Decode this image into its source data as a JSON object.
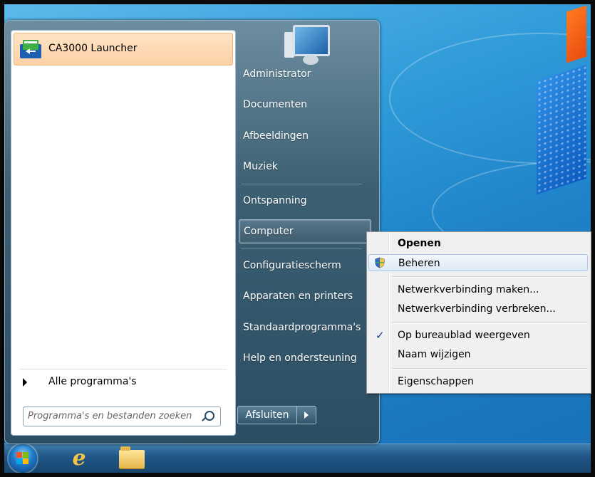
{
  "colors": {
    "accent": "#fdd1a6",
    "desktop": "#2e9ad8",
    "menu_text": "#ffffff"
  },
  "start_menu": {
    "pinned": [
      {
        "label": "CA3000 Launcher",
        "icon": "ca3000-launcher-icon"
      }
    ],
    "all_programs_label": "Alle programma's",
    "search_placeholder": "Programma's en bestanden zoeken",
    "right_pane": [
      {
        "label": "Administrator"
      },
      {
        "label": "Documenten"
      },
      {
        "label": "Afbeeldingen"
      },
      {
        "label": "Muziek"
      },
      {
        "label": "Ontspanning"
      },
      {
        "label": "Computer"
      },
      {
        "label": "Configuratiescherm"
      },
      {
        "label": "Apparaten en printers"
      },
      {
        "label": "Standaardprogramma's"
      },
      {
        "label": "Help en ondersteuning"
      }
    ],
    "shutdown_label": "Afsluiten"
  },
  "context_menu": {
    "items": [
      {
        "label": "Openen"
      },
      {
        "label": "Beheren",
        "icon": "uac-shield-icon"
      },
      {
        "label": "Netwerkverbinding maken..."
      },
      {
        "label": "Netwerkverbinding verbreken..."
      },
      {
        "label": "Op bureaublad weergeven",
        "icon": "checkmark-icon"
      },
      {
        "label": "Naam wijzigen"
      },
      {
        "label": "Eigenschappen"
      }
    ]
  },
  "taskbar": {
    "items": [
      "start-orb-icon",
      "internet-explorer-icon",
      "windows-explorer-icon"
    ]
  }
}
